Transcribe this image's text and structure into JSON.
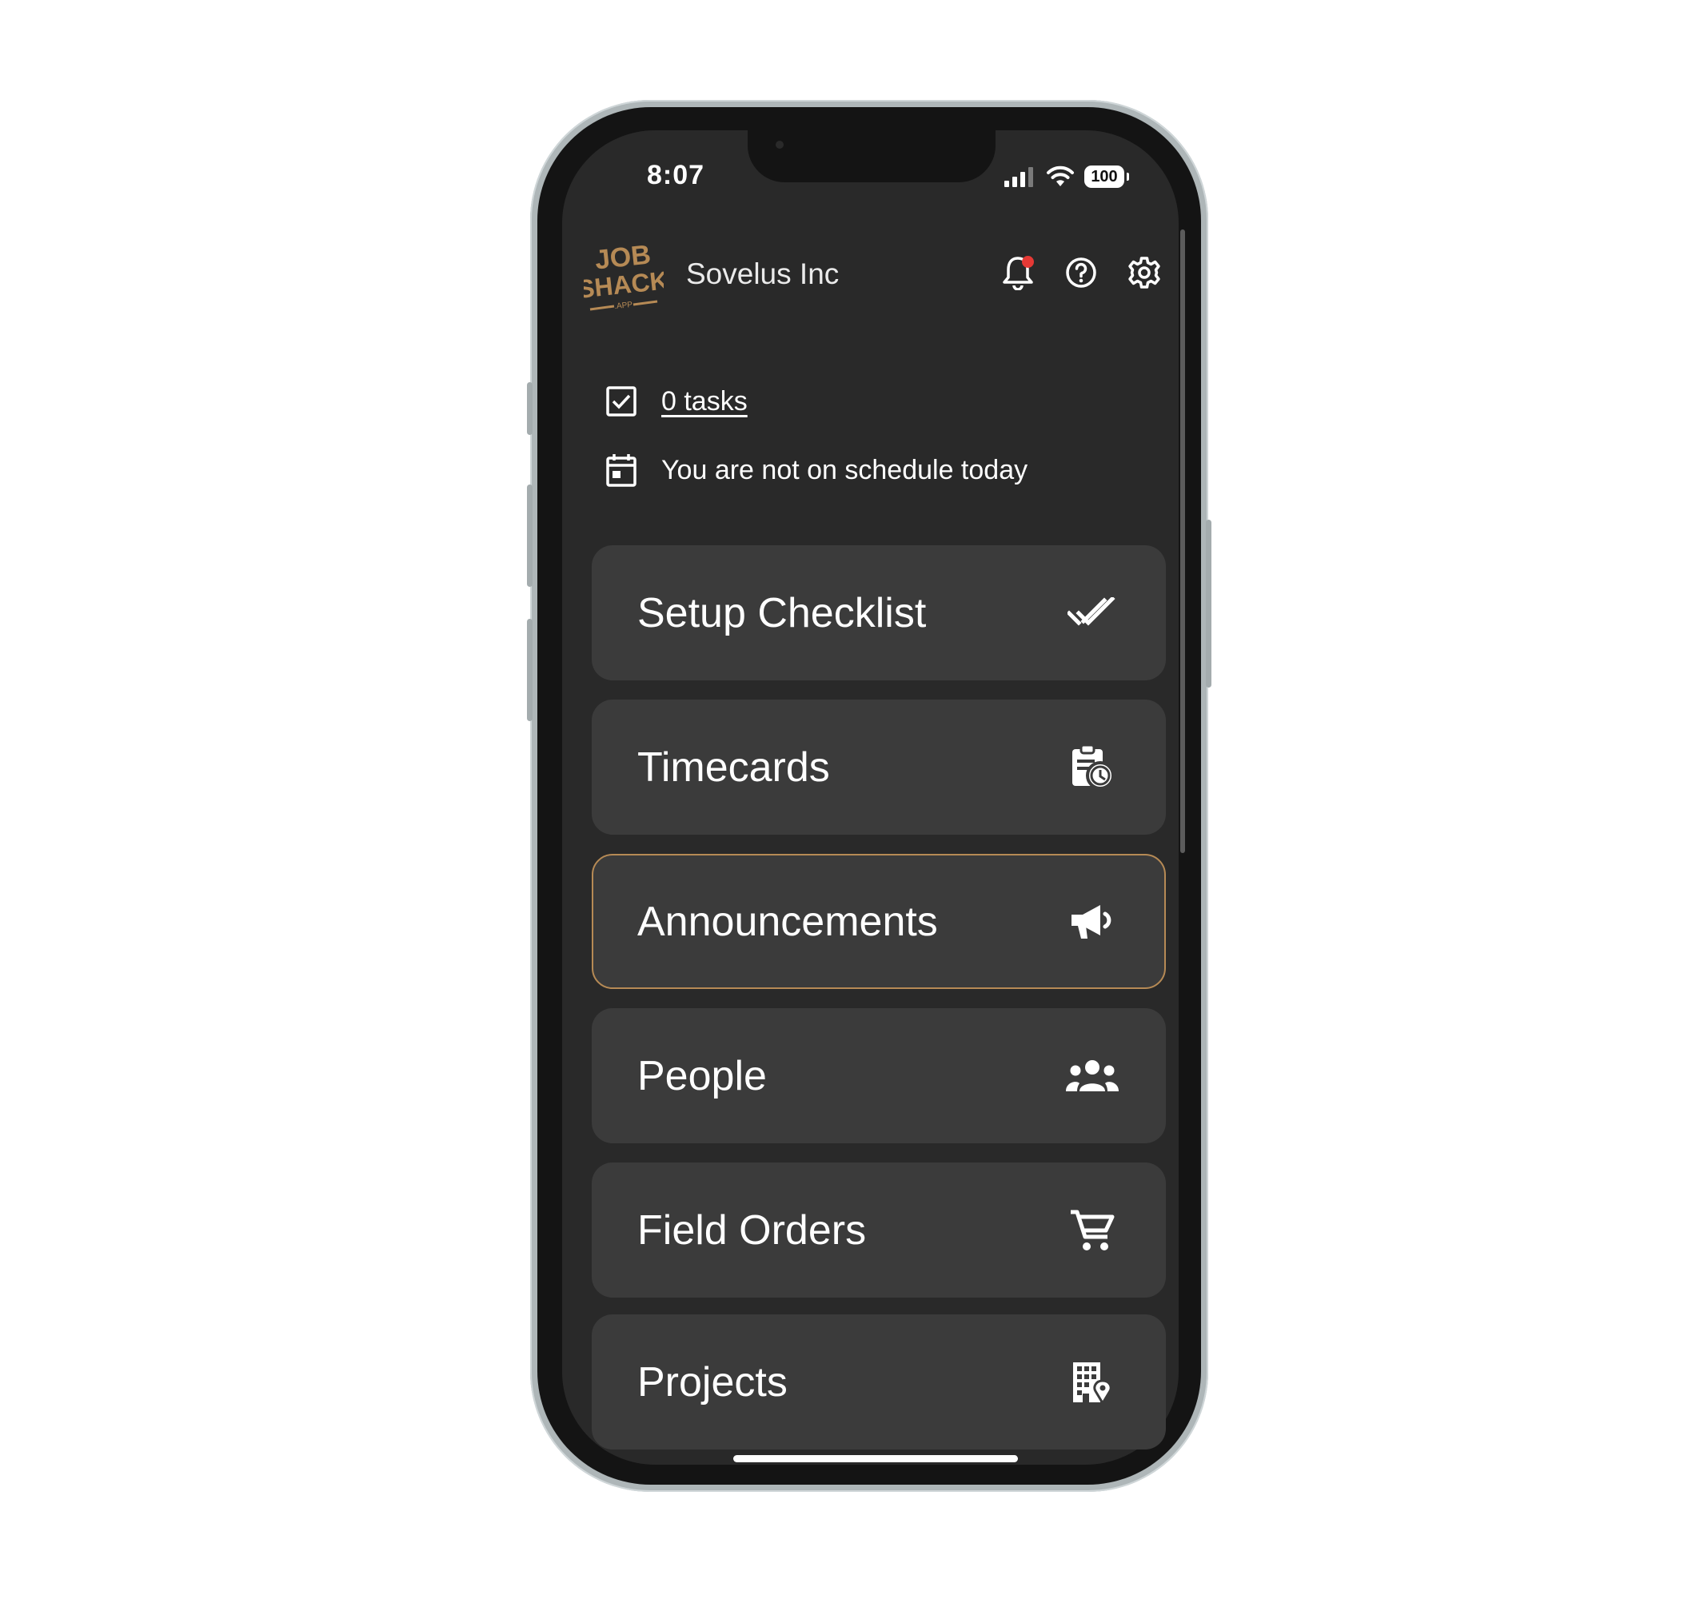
{
  "status_bar": {
    "time": "8:07",
    "battery": "100"
  },
  "header": {
    "logo_text": [
      "JOB",
      "SHACK",
      ".APP"
    ],
    "company": "Sovelus Inc",
    "icons": [
      "bell-icon",
      "help-icon",
      "gear-icon"
    ]
  },
  "info": {
    "tasks": "0 tasks",
    "schedule": "You are not on schedule today"
  },
  "cards": [
    {
      "label": "Setup Checklist",
      "icon": "double-check-icon"
    },
    {
      "label": "Timecards",
      "icon": "timecard-clock-icon"
    },
    {
      "label": "Announcements",
      "icon": "megaphone-icon",
      "active": true
    },
    {
      "label": "People",
      "icon": "people-icon"
    },
    {
      "label": "Field Orders",
      "icon": "cart-icon"
    },
    {
      "label": "Projects",
      "icon": "building-location-icon"
    }
  ],
  "colors": {
    "background": "#292929",
    "card": "#3b3b3b",
    "accent": "#b68a55",
    "notification_dot": "#e53935"
  }
}
